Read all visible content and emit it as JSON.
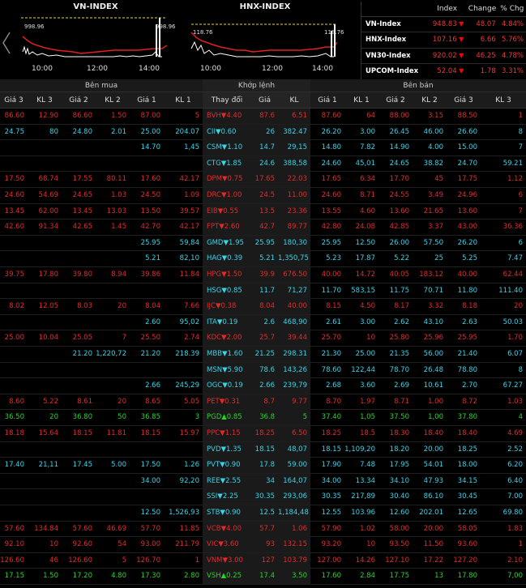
{
  "index_charts": [
    {
      "title": "VN-INDEX",
      "ref_left": "998.96",
      "ref_right": "998.96",
      "ticks": [
        "10:00",
        "12:00",
        "14:00"
      ]
    },
    {
      "title": "HNX-INDEX",
      "ref_left": "118.76",
      "ref_right": "118.76",
      "ticks": [
        "10:00",
        "12:00",
        "14:00"
      ]
    }
  ],
  "index_table": {
    "headers": [
      "",
      "Index",
      "Change",
      "% Chg"
    ],
    "rows": [
      {
        "name": "VN-Index",
        "index": "948.83",
        "change": "48.07",
        "pct": "4.84%"
      },
      {
        "name": "HNX-Index",
        "index": "107.16",
        "change": "6.66",
        "pct": "5.76%"
      },
      {
        "name": "VN30-Index",
        "index": "920.02",
        "change": "46.25",
        "pct": "4.78%"
      },
      {
        "name": "UPCOM-Index",
        "index": "52.04",
        "change": "1.78",
        "pct": "3.31%"
      }
    ]
  },
  "board": {
    "groups": {
      "buy": "Bên mua",
      "match": "Khớp lệnh",
      "sell": "Bên bán"
    },
    "columns": [
      "Giá 3",
      "KL 3",
      "Giá 2",
      "KL 2",
      "Giá 1",
      "KL 1",
      "Thay đổi",
      "Giá",
      "KL",
      "Giá 1",
      "KL 1",
      "Giá 2",
      "KL 2",
      "Giá 3",
      "KL 3"
    ],
    "rows": [
      {
        "c": "red",
        "v": [
          "86.60",
          "12.90",
          "86.60",
          "1.50",
          "87.00",
          "5",
          "BVH▼4.40",
          "87.6",
          "6.51",
          "87.60",
          "64",
          "88.00",
          "3.15",
          "88.50",
          "1"
        ]
      },
      {
        "c": "cyan",
        "v": [
          "24.75",
          "80",
          "24.80",
          "2.01",
          "25.00",
          "204.07",
          "CII▼0.60",
          "26",
          "382.47",
          "26.20",
          "3.00",
          "26.45",
          "46.00",
          "26.60",
          "8"
        ]
      },
      {
        "c": "cyan",
        "v": [
          "",
          "",
          "",
          "",
          "14.70",
          "1,45",
          "CSM▼1.10",
          "14.7",
          "29,15",
          "14.80",
          "7.82",
          "14.90",
          "4.00",
          "15.00",
          "7"
        ]
      },
      {
        "c": "cyan",
        "v": [
          "",
          "",
          "",
          "",
          "",
          "",
          "CTG▼1.85",
          "24.6",
          "388,58",
          "24.60",
          "45,01",
          "24.65",
          "38.82",
          "24.70",
          "59.21"
        ]
      },
      {
        "c": "red",
        "v": [
          "17.50",
          "68.74",
          "17.55",
          "80.11",
          "17.60",
          "42.17",
          "DPM▼0.75",
          "17.65",
          "22.03",
          "17.65",
          "6.34",
          "17.70",
          "45",
          "17.75",
          "1.12"
        ]
      },
      {
        "c": "red",
        "v": [
          "24.60",
          "54.69",
          "24.65",
          "1.03",
          "24.50",
          "1.09",
          "DRC▼1.00",
          "24.5",
          "11.00",
          "24.60",
          "8.71",
          "24.55",
          "3.49",
          "24.96",
          "6"
        ]
      },
      {
        "c": "red",
        "v": [
          "13.45",
          "62.00",
          "13.45",
          "13.03",
          "13.50",
          "39.57",
          "EIB▼0.55",
          "13.5",
          "23.36",
          "13.55",
          "4.60",
          "13.60",
          "21.65",
          "13.60",
          "7"
        ]
      },
      {
        "c": "red",
        "v": [
          "42.60",
          "91.34",
          "42.65",
          "1.45",
          "42.70",
          "42.17",
          "FPT▼2.60",
          "42.7",
          "89.77",
          "42.80",
          "24.08",
          "42.85",
          "3.37",
          "43.00",
          "36.36"
        ]
      },
      {
        "c": "cyan",
        "v": [
          "",
          "",
          "",
          "",
          "25.95",
          "59,84",
          "GMD▼1.95",
          "25.95",
          "180,30",
          "25.95",
          "12.50",
          "26.00",
          "57.50",
          "26.20",
          "6"
        ]
      },
      {
        "c": "cyan",
        "v": [
          "",
          "",
          "",
          "",
          "5.21",
          "82,10",
          "HAG▼0.39",
          "5.21",
          "1,350,75",
          "5.23",
          "17.87",
          "5.22",
          "25",
          "5.25",
          "7.47"
        ]
      },
      {
        "c": "red",
        "v": [
          "39.75",
          "17.80",
          "39.80",
          "8.94",
          "39.86",
          "11.84",
          "HPG▼1.50",
          "39.9",
          "676.50",
          "40.00",
          "14.72",
          "40.05",
          "183.12",
          "40.00",
          "62.44"
        ]
      },
      {
        "c": "cyan",
        "v": [
          "",
          "",
          "",
          "",
          "",
          "",
          "HSG▼0.85",
          "11.7",
          "71,27",
          "11.70",
          "583,15",
          "11.75",
          "70.71",
          "11.80",
          "111.40"
        ]
      },
      {
        "c": "red",
        "v": [
          "8.02",
          "12.05",
          "8.03",
          "20",
          "8.04",
          "7.66",
          "IJC▼0.38",
          "8.04",
          "40.00",
          "8.15",
          "4.50",
          "8.17",
          "3.32",
          "8.18",
          "20"
        ]
      },
      {
        "c": "cyan",
        "v": [
          "",
          "",
          "",
          "",
          "2.60",
          "95,02",
          "ITA▼0.19",
          "2.6",
          "468,90",
          "2.61",
          "3.00",
          "2.62",
          "43.10",
          "2.63",
          "50.03"
        ]
      },
      {
        "c": "red",
        "v": [
          "25.00",
          "10.04",
          "25.05",
          "7",
          "25.50",
          "2.74",
          "KDC▼2.00",
          "25.7",
          "39.44",
          "25.70",
          "10",
          "25.80",
          "25.96",
          "25.95",
          "1.70"
        ]
      },
      {
        "c": "cyan",
        "v": [
          "",
          "",
          "21.20",
          "1,220,72",
          "21.20",
          "218.39",
          "MBB▼1.60",
          "21.25",
          "298.31",
          "21.30",
          "25.00",
          "21.35",
          "56.00",
          "21.40",
          "6.07"
        ]
      },
      {
        "c": "cyan",
        "v": [
          "",
          "",
          "",
          "",
          "",
          "",
          "MSN▼5.90",
          "78.6",
          "143,26",
          "78.60",
          "122,44",
          "78.70",
          "26.48",
          "78.80",
          "8"
        ]
      },
      {
        "c": "cyan",
        "v": [
          "",
          "",
          "",
          "",
          "2.66",
          "245,29",
          "OGC▼0.19",
          "2.66",
          "239,79",
          "2.68",
          "3.60",
          "2.69",
          "10.61",
          "2.70",
          "67.27"
        ]
      },
      {
        "c": "red",
        "v": [
          "8.60",
          "5.22",
          "8.61",
          "20",
          "8.65",
          "5.05",
          "PET▼0.31",
          "8.7",
          "9.77",
          "8.70",
          "1.97",
          "8.71",
          "1.00",
          "8.72",
          "1.03"
        ]
      },
      {
        "c": "green",
        "v": [
          "36.50",
          "20",
          "36.80",
          "50",
          "36.85",
          "3",
          "PGD▲0.85",
          "36.8",
          "5",
          "37.40",
          "1,05",
          "37.50",
          "1,00",
          "37.80",
          "4"
        ]
      },
      {
        "c": "red",
        "v": [
          "18.18",
          "15.64",
          "18.15",
          "11.81",
          "18.15",
          "15.97",
          "PPC▼1.15",
          "18.25",
          "6.50",
          "18.25",
          "18.5",
          "18.30",
          "18.40",
          "18.40",
          "4.69"
        ]
      },
      {
        "c": "cyan",
        "v": [
          "",
          "",
          "",
          "",
          "",
          "",
          "PVD▼1.35",
          "18.15",
          "48,07",
          "18.15",
          "1,109,20",
          "18.20",
          "20.00",
          "18.25",
          "2.52"
        ]
      },
      {
        "c": "cyan",
        "v": [
          "17.40",
          "21,11",
          "17.45",
          "5.00",
          "17.50",
          "1.26",
          "PVT▼0.90",
          "17.8",
          "59.00",
          "17.90",
          "7.48",
          "17.95",
          "54.01",
          "18.00",
          "6.20"
        ]
      },
      {
        "c": "cyan",
        "v": [
          "",
          "",
          "",
          "",
          "34.00",
          "92,20",
          "REE▼2.55",
          "34",
          "164,07",
          "34.00",
          "13.34",
          "34.10",
          "47.93",
          "34.15",
          "6.40"
        ]
      },
      {
        "c": "cyan",
        "v": [
          "",
          "",
          "",
          "",
          "",
          "",
          "SSI▼2.25",
          "30.35",
          "293,06",
          "30.35",
          "217,89",
          "30.40",
          "86.10",
          "30.45",
          "7.00"
        ]
      },
      {
        "c": "cyan",
        "v": [
          "",
          "",
          "",
          "",
          "12.50",
          "1,526,93",
          "STB▼0.90",
          "12.5",
          "1,184,48",
          "12.55",
          "103.96",
          "12.60",
          "202.01",
          "12.65",
          "69.80"
        ]
      },
      {
        "c": "red",
        "v": [
          "57.60",
          "134.84",
          "57.60",
          "46.69",
          "57.70",
          "11.85",
          "VCB▼4.00",
          "57.7",
          "1.06",
          "57.90",
          "1.02",
          "58.00",
          "20.00",
          "58.05",
          "1.83"
        ]
      },
      {
        "c": "red",
        "v": [
          "92.10",
          "10",
          "92.60",
          "54",
          "93.00",
          "211.79",
          "VIC▼3.60",
          "93",
          "132.15",
          "93.20",
          "10",
          "93.50",
          "11.50",
          "93.60",
          "1"
        ]
      },
      {
        "c": "red",
        "v": [
          "126.60",
          "46",
          "126.60",
          "5",
          "126.70",
          "1",
          "VNM▼3.00",
          "127",
          "103.79",
          "127.00",
          "14.26",
          "127.10",
          "17.22",
          "127.20",
          "2.10"
        ]
      },
      {
        "c": "green",
        "v": [
          "17.15",
          "1.50",
          "17.20",
          "4.80",
          "17.30",
          "2.80",
          "VSH▲0.25",
          "17.4",
          "3.50",
          "17.60",
          "2.84",
          "17.75",
          "13",
          "17.80",
          "7,00"
        ]
      }
    ]
  },
  "colors": {
    "up": "#28d428",
    "down": "#e12b2b",
    "floor": "#38d4e8",
    "bg": "#000000"
  }
}
